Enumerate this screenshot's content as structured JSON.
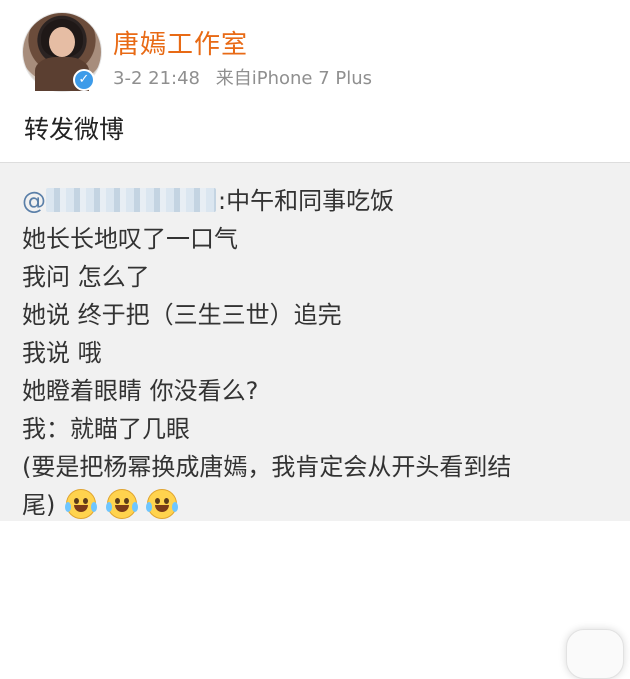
{
  "post": {
    "username": "唐嫣工作室",
    "time": "3-2 21:48",
    "source": "来自iPhone 7 Plus",
    "text": "转发微博"
  },
  "repost": {
    "at_symbol": "@",
    "mention_text": ":中午和同事吃饭",
    "lines": [
      "她长长地叹了一口气",
      "我问 怎么了",
      "她说 终于把（三生三世）追完",
      "我说 哦",
      "她瞪着眼睛 你没看么?",
      "我：就瞄了几眼",
      "(要是把杨幂换成唐嫣，我肯定会从开头看到结",
      "尾)"
    ]
  },
  "icons": {
    "verified": "verified-badge-icon",
    "emoji": "laugh-crying-emoji-icon"
  },
  "colors": {
    "username": "#e86a15",
    "meta": "#8f8f8f",
    "repost_bg": "#f1f1f1",
    "verified": "#3d9be9"
  }
}
